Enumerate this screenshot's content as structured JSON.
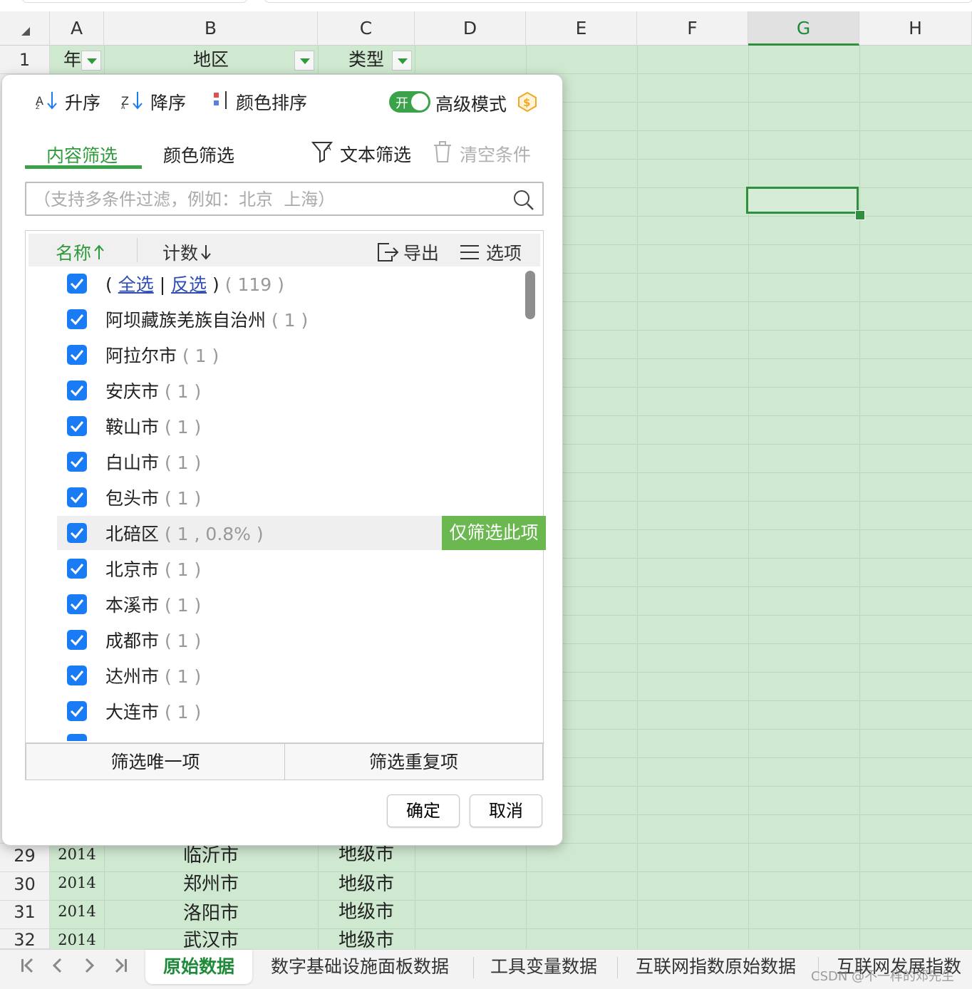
{
  "sheet": {
    "columns": [
      "A",
      "B",
      "C",
      "D",
      "E",
      "F",
      "G",
      "H"
    ],
    "selected_column": "G",
    "header_row": {
      "row": "1",
      "a": "年",
      "b": "地区",
      "c": "类型"
    },
    "rows": [
      {
        "row": "29",
        "year": "2014",
        "region": "临沂市",
        "type": "地级市"
      },
      {
        "row": "30",
        "year": "2014",
        "region": "郑州市",
        "type": "地级市"
      },
      {
        "row": "31",
        "year": "2014",
        "region": "洛阳市",
        "type": "地级市"
      },
      {
        "row": "32",
        "year": "2014",
        "region": "武汉市",
        "type": "地级市"
      }
    ]
  },
  "dialog": {
    "sort_asc": "升序",
    "sort_desc": "降序",
    "color_sort": "颜色排序",
    "toggle_label": "开",
    "advanced_mode": "高级模式",
    "tab_content": "内容筛选",
    "tab_color": "颜色筛选",
    "text_filter": "文本筛选",
    "clear_conditions": "清空条件",
    "search_placeholder": "（支持多条件过滤，例如：北京  上海）",
    "col_name": "名称",
    "col_count": "计数",
    "export": "导出",
    "options": "选项",
    "select_all_open": "(",
    "select_all": "全选",
    "select_sep": "|",
    "invert": "反选",
    "select_all_close": ")",
    "total": "( 119 )",
    "items": [
      {
        "name": "阿坝藏族羌族自治州",
        "count": "( 1 )"
      },
      {
        "name": "阿拉尔市",
        "count": "( 1 )"
      },
      {
        "name": "安庆市",
        "count": "( 1 )"
      },
      {
        "name": "鞍山市",
        "count": "( 1 )"
      },
      {
        "name": "白山市",
        "count": "( 1 )"
      },
      {
        "name": "包头市",
        "count": "( 1 )"
      },
      {
        "name": "北碚区",
        "count": "( 1 , 0.8% )"
      },
      {
        "name": "北京市",
        "count": "( 1 )"
      },
      {
        "name": "本溪市",
        "count": "( 1 )"
      },
      {
        "name": "成都市",
        "count": "( 1 )"
      },
      {
        "name": "达州市",
        "count": "( 1 )"
      },
      {
        "name": "大连市",
        "count": "( 1 )"
      }
    ],
    "only_filter": "仅筛选此项",
    "filter_unique": "筛选唯一项",
    "filter_duplicate": "筛选重复项",
    "ok": "确定",
    "cancel": "取消"
  },
  "tabs": [
    "原始数据",
    "数字基础设施面板数据",
    "工具变量数据",
    "互联网指数原始数据",
    "互联网发展指数"
  ],
  "active_tab": "原始数据",
  "watermark": "CSDN @不一样的邓先生",
  "colors": {
    "accent": "#3aa34a",
    "grid": "#cfe8d0",
    "checkbox": "#1a7cf5",
    "only_btn": "#6ab84f"
  }
}
